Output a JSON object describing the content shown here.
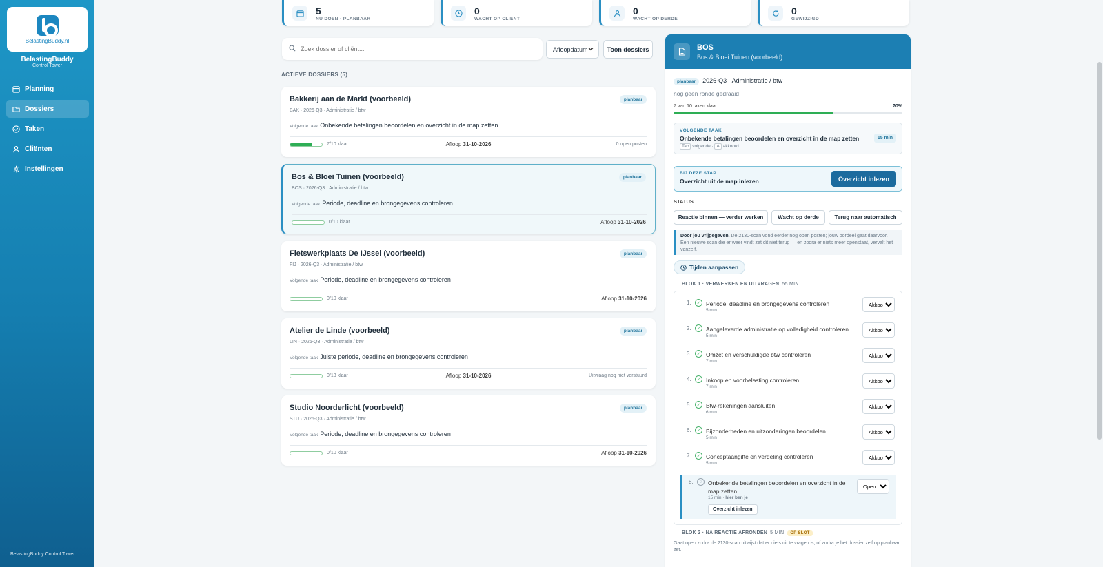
{
  "brand": {
    "logo_text": "BelastingBuddy.nl",
    "name": "BelastingBuddy",
    "sub": "Control Tower",
    "footer": "BelastingBuddy Control Tower",
    "accent": "#1c7fb3"
  },
  "nav": [
    {
      "label": "Planning",
      "icon": "calendar-icon"
    },
    {
      "label": "Dossiers",
      "icon": "folder-icon",
      "active": true
    },
    {
      "label": "Taken",
      "icon": "check-circle-icon"
    },
    {
      "label": "Cliënten",
      "icon": "user-icon"
    },
    {
      "label": "Instellingen",
      "icon": "gear-icon"
    }
  ],
  "stats": [
    {
      "num": "5",
      "label": "NU DOEN · PLANBAAR",
      "icon": "calendar-icon"
    },
    {
      "num": "0",
      "label": "WACHT OP CLIENT",
      "icon": "clock-icon"
    },
    {
      "num": "0",
      "label": "WACHT OP DERDE",
      "icon": "user-icon"
    },
    {
      "num": "0",
      "label": "GEWIJZIGD",
      "icon": "refresh-icon"
    }
  ],
  "toolbar": {
    "search_placeholder": "Zoek dossier of cliënt...",
    "sort_value": "Afloopdatum",
    "show_button": "Toon dossiers"
  },
  "section_title": "ACTIEVE DOSSIERS (5)",
  "dossiers": [
    {
      "title": "Bakkerij aan de Markt (voorbeeld)",
      "badge": "planbaar",
      "meta": "BAK · 2026-Q3 · Administratie / btw",
      "next_label": "Volgende taak",
      "next": "Onbekende betalingen beoordelen en overzicht in de map zetten",
      "progress": 0.7,
      "progress_label": "7/10 klaar",
      "due_label": "Afloop",
      "due_date": "31-10-2026",
      "right_note": "0 open posten"
    },
    {
      "title": "Bos & Bloei Tuinen (voorbeeld)",
      "badge": "planbaar",
      "meta": "BOS · 2026-Q3 · Administratie / btw",
      "next_label": "Volgende taak",
      "next": "Periode, deadline en brongegevens controleren",
      "progress": 0,
      "progress_label": "0/10 klaar",
      "due_label": "Afloop",
      "due_date": "31-10-2026"
    },
    {
      "title": "Fietswerkplaats De IJssel (voorbeeld)",
      "badge": "planbaar",
      "meta": "FIJ · 2026-Q3 · Administratie / btw",
      "next_label": "Volgende taak",
      "next": "Periode, deadline en brongegevens controleren",
      "progress": 0,
      "progress_label": "0/10 klaar",
      "due_label": "Afloop",
      "due_date": "31-10-2026"
    },
    {
      "title": "Atelier de Linde (voorbeeld)",
      "badge": "planbaar",
      "meta": "LIN · 2026-Q3 · Administratie / btw",
      "next_label": "Volgende taak",
      "next": "Juiste periode, deadline en brongegevens controleren",
      "progress": 0,
      "progress_label": "0/13 klaar",
      "due_label": "Afloop",
      "due_date": "31-10-2026",
      "right_note": "Uitvraag nog niet verstuurd"
    },
    {
      "title": "Studio Noorderlicht (voorbeeld)",
      "badge": "planbaar",
      "meta": "STU · 2026-Q3 · Administratie / btw",
      "next_label": "Volgende taak",
      "next": "Periode, deadline en brongegevens controleren",
      "progress": 0,
      "progress_label": "0/10 klaar",
      "due_label": "Afloop",
      "due_date": "31-10-2026"
    }
  ],
  "detail": {
    "code": "BOS",
    "name": "Bos & Bloei Tuinen (voorbeeld)",
    "badge": "planbaar",
    "period": "2026-Q3 · Administratie / btw",
    "round_note": "nog geen ronde gedraaid",
    "tasks_done": "7 van 10 taken klaar",
    "percent": "70%",
    "progress": 0.7,
    "next_task": {
      "label": "VOLGENDE TAAK",
      "text": "Onbekende betalingen beoordelen en overzicht in de map zetten",
      "duration": "15 min",
      "key1": "Tab",
      "key1_text": "volgende ·",
      "key2": "A",
      "key2_text": "akkoord"
    },
    "step": {
      "label": "BIJ DEZE STAP",
      "text": "Overzicht uit de map inlezen",
      "button": "Overzicht inlezen"
    },
    "status_title": "STATUS",
    "status_buttons": [
      "Reactie binnen — verder werken",
      "Wacht op derde",
      "Terug naar automatisch"
    ],
    "note_bold": "Door jou vrijgegeven.",
    "note": "De 2130-scan vond eerder nog open posten; jouw oordeel gaat daarvoor. Een nieuwe scan die er weer vindt zet dit niet terug — en zodra er niets meer openstaat, vervalt het vanzelf.",
    "times_button": "Tijden aanpassen",
    "blok1_title": "BLOK 1 · VERWERKEN EN UITVRAGEN",
    "blok1_mins": "55 MIN",
    "tasks": [
      {
        "num": "1.",
        "name": "Periode, deadline en brongegevens controleren",
        "dur": "5 min",
        "status": "Akkoord"
      },
      {
        "num": "2.",
        "name": "Aangeleverde administratie op volledigheid controleren",
        "dur": "5 min",
        "status": "Akkoord"
      },
      {
        "num": "3.",
        "name": "Omzet en verschuldigde btw controleren",
        "dur": "7 min",
        "status": "Akkoord"
      },
      {
        "num": "4.",
        "name": "Inkoop en voorbelasting controleren",
        "dur": "7 min",
        "status": "Akkoord"
      },
      {
        "num": "5.",
        "name": "Btw-rekeningen aansluiten",
        "dur": "6 min",
        "status": "Akkoord"
      },
      {
        "num": "6.",
        "name": "Bijzonderheden en uitzonderingen beoordelen",
        "dur": "5 min",
        "status": "Akkoord"
      },
      {
        "num": "7.",
        "name": "Conceptaangifte en verdeling controleren",
        "dur": "5 min",
        "status": "Akkoord"
      }
    ],
    "current_task": {
      "num": "8.",
      "name": "Onbekende betalingen beoordelen en overzicht in de map zetten",
      "dur": "15 min ·",
      "here": "hier ben je",
      "status": "Open",
      "button": "Overzicht inlezen"
    },
    "blok2_title": "BLOK 2 · NA REACTIE AFRONDEN",
    "blok2_mins": "5 MIN",
    "blok2_lock": "OP SLOT",
    "blok2_note": "Gaat open zodra de 2130-scan uitwijst dat er niets uit te vragen is, of zodra je het dossier zelf op planbaar zet."
  }
}
